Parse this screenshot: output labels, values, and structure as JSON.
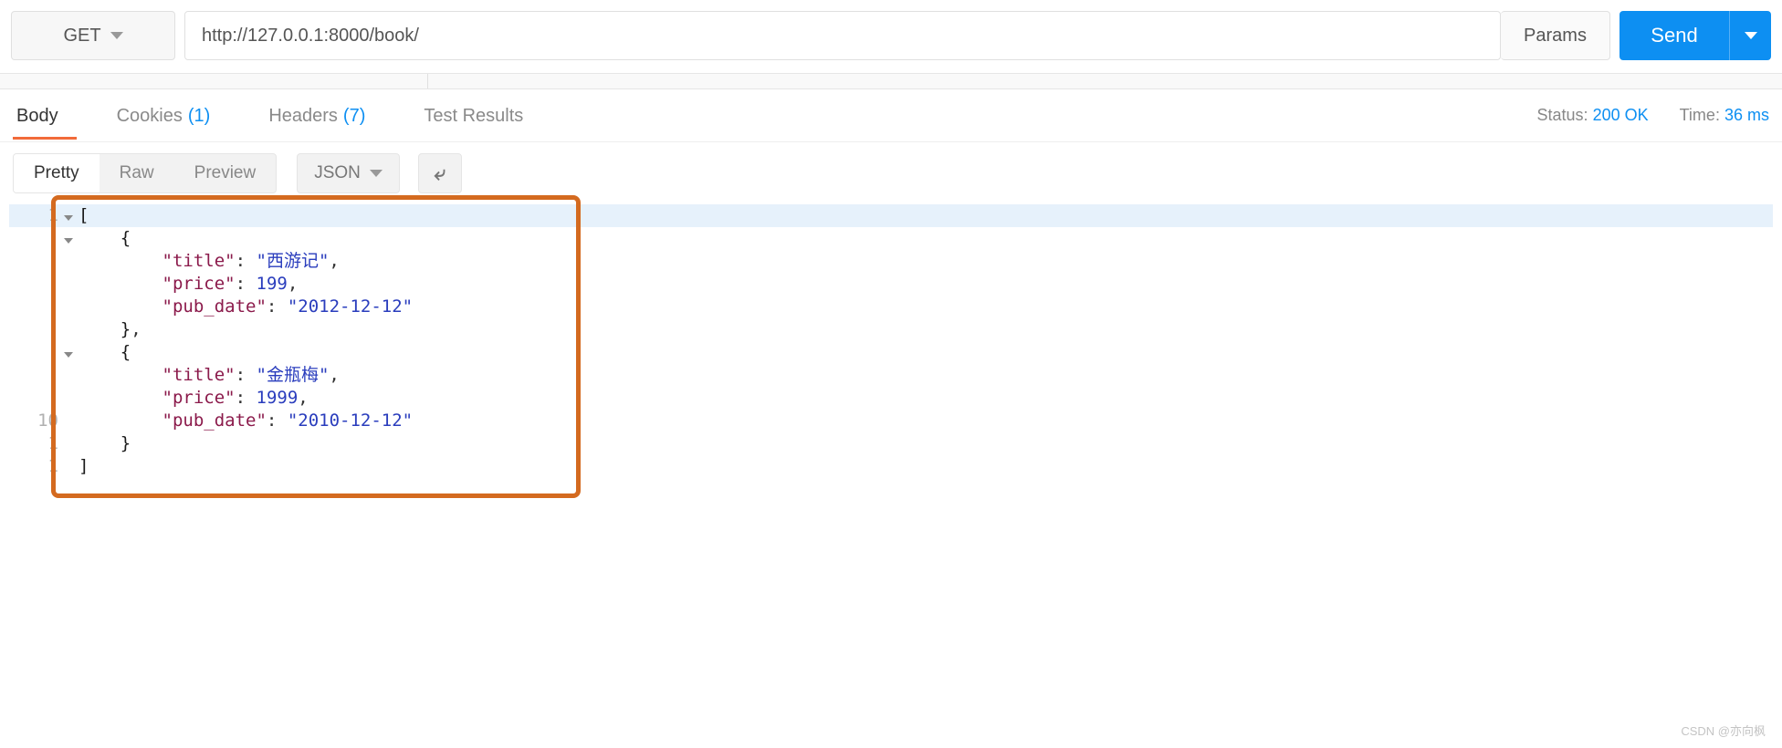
{
  "request": {
    "method": "GET",
    "url": "http://127.0.0.1:8000/book/",
    "params_label": "Params",
    "send_label": "Send"
  },
  "response_tabs": {
    "body": "Body",
    "cookies": "Cookies",
    "cookies_count": "(1)",
    "headers": "Headers",
    "headers_count": "(7)",
    "tests": "Test Results"
  },
  "status": {
    "status_label": "Status:",
    "status_value": "200 OK",
    "time_label": "Time:",
    "time_value": "36 ms"
  },
  "viewer": {
    "pretty": "Pretty",
    "raw": "Raw",
    "preview": "Preview",
    "format": "JSON"
  },
  "json_body": [
    {
      "title": "西游记",
      "price": 199,
      "pub_date": "2012-12-12"
    },
    {
      "title": "金瓶梅",
      "price": 1999,
      "pub_date": "2010-12-12"
    }
  ],
  "line_numbers": [
    "1",
    "",
    "",
    "",
    "",
    "",
    "",
    "",
    "",
    "10",
    "1",
    "1"
  ],
  "watermark": "CSDN @亦向枫"
}
